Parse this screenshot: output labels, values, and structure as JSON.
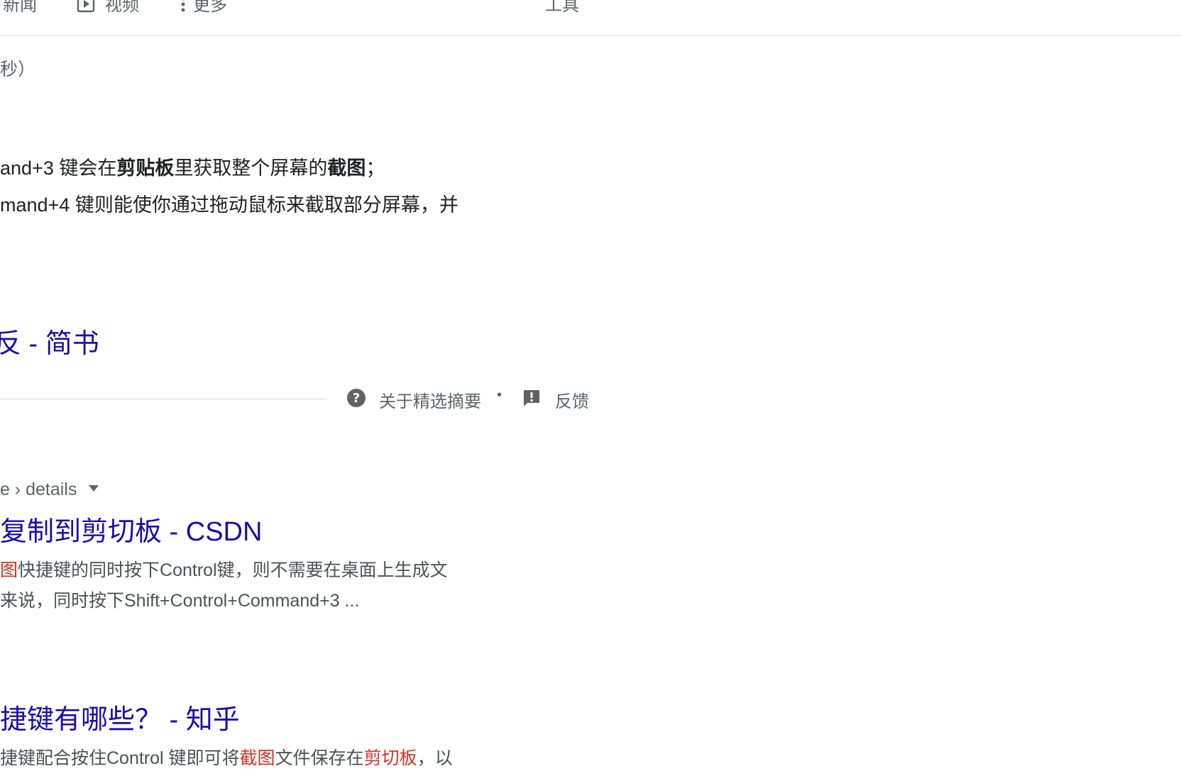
{
  "nav": {
    "news_label": "新闻",
    "videos_label": "视频",
    "more_label": "更多",
    "tools_label": "工具"
  },
  "result_stats": "秒）",
  "featured_snippet": {
    "line1_pre": "and+3 键会在",
    "line1_bold1": "剪贴板",
    "line1_mid": "里获取整个屏幕的",
    "line1_bold2": "截图",
    "line1_post": "；",
    "line2": "mand+4 键则能使你通过拖动鼠标来截取部分屏幕，并",
    "source_title": "反 - 简书"
  },
  "featured_footer": {
    "about_label": "关于精选摘要",
    "separator": "•",
    "feedback_label": "反馈"
  },
  "results": [
    {
      "breadcrumb": "e › details",
      "title": "复制到剪切板 - CSDN",
      "snippet_line1_hl": "图",
      "snippet_line1_rest": "快捷键的同时按下Control键，则不需要在桌面上生成文",
      "snippet_line2": "来说，同时按下Shift+Control+Command+3 ..."
    },
    {
      "title": "捷键有哪些？ - 知乎",
      "snippet_pre": "捷键配合按住Control 键即可将",
      "snippet_hl1": "截图",
      "snippet_mid": "文件保存在",
      "snippet_hl2": "剪切板",
      "snippet_post": "，以"
    }
  ],
  "colors": {
    "link": "#1a0dab",
    "highlight": "#d93025",
    "muted": "#5f6368"
  }
}
